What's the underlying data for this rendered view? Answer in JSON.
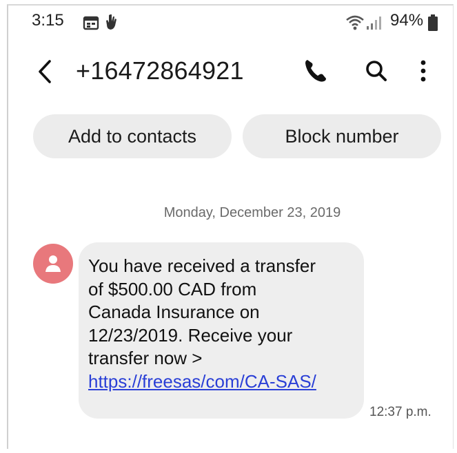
{
  "status_bar": {
    "time": "3:15",
    "battery_percent": "94%",
    "icons": [
      "calendar-icon",
      "hand-icon",
      "wifi-icon",
      "signal-icon",
      "battery-icon"
    ]
  },
  "header": {
    "contact_number": "+16472864921",
    "icons": [
      "back-arrow-icon",
      "phone-icon",
      "search-icon",
      "more-vert-icon"
    ]
  },
  "actions": {
    "add_to_contacts": "Add to contacts",
    "block_number": "Block number"
  },
  "conversation": {
    "date_header": "Monday, December 23, 2019",
    "messages": [
      {
        "lines": [
          "You have received a transfer",
          "of $500.00 CAD from",
          "Canada Insurance on",
          "12/23/2019. Receive your",
          "transfer now >"
        ],
        "link": "https://freesas/com/CA-SAS/",
        "time": "12:37 p.m."
      }
    ]
  },
  "colors": {
    "avatar": "#e8787c",
    "bubble": "#eeeeee",
    "pill": "#ececec",
    "link": "#2a3fd6"
  }
}
